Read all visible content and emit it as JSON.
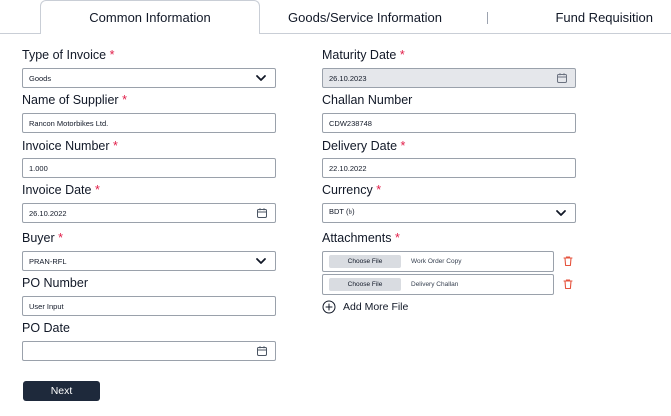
{
  "tabs": [
    {
      "label": "Common Information"
    },
    {
      "label": "Goods/Service Information"
    },
    {
      "label": "Fund Requisition"
    }
  ],
  "form": {
    "type_of_invoice": {
      "label": "Type of Invoice",
      "required": "*",
      "value": "Goods"
    },
    "name_of_supplier": {
      "label": "Name of Supplier",
      "required": "*",
      "value": "Rancon Motorbikes Ltd."
    },
    "invoice_number": {
      "label": "Invoice Number",
      "required": "*",
      "value": "1.000"
    },
    "invoice_date": {
      "label": "Invoice Date",
      "required": "*",
      "value": "26.10.2022"
    },
    "buyer": {
      "label": "Buyer",
      "required": "*",
      "value": "PRAN-RFL"
    },
    "po_number": {
      "label": "PO Number",
      "value": "User Input"
    },
    "po_date": {
      "label": "PO Date",
      "value": ""
    },
    "maturity_date": {
      "label": "Maturity Date",
      "required": "*",
      "value": "26.10.2023"
    },
    "challan_number": {
      "label": "Challan Number",
      "value": "CDW238748"
    },
    "delivery_date": {
      "label": "Delivery Date",
      "required": "*",
      "value": "22.10.2022"
    },
    "currency": {
      "label": "Currency",
      "required": "*",
      "value": "BDT (৳)"
    },
    "attachments": {
      "label": "Attachments",
      "required": "*",
      "files": [
        {
          "button": "Choose File",
          "name": "Work Order Copy"
        },
        {
          "button": "Choose File",
          "name": "Delivery Challan"
        }
      ],
      "add_more": "Add More File"
    }
  },
  "actions": {
    "next": "Next"
  },
  "colors": {
    "required": "#e11d48",
    "trash": "#e5533d",
    "primary_button": "#1e293b",
    "disabled_field": "#e5e7eb"
  }
}
